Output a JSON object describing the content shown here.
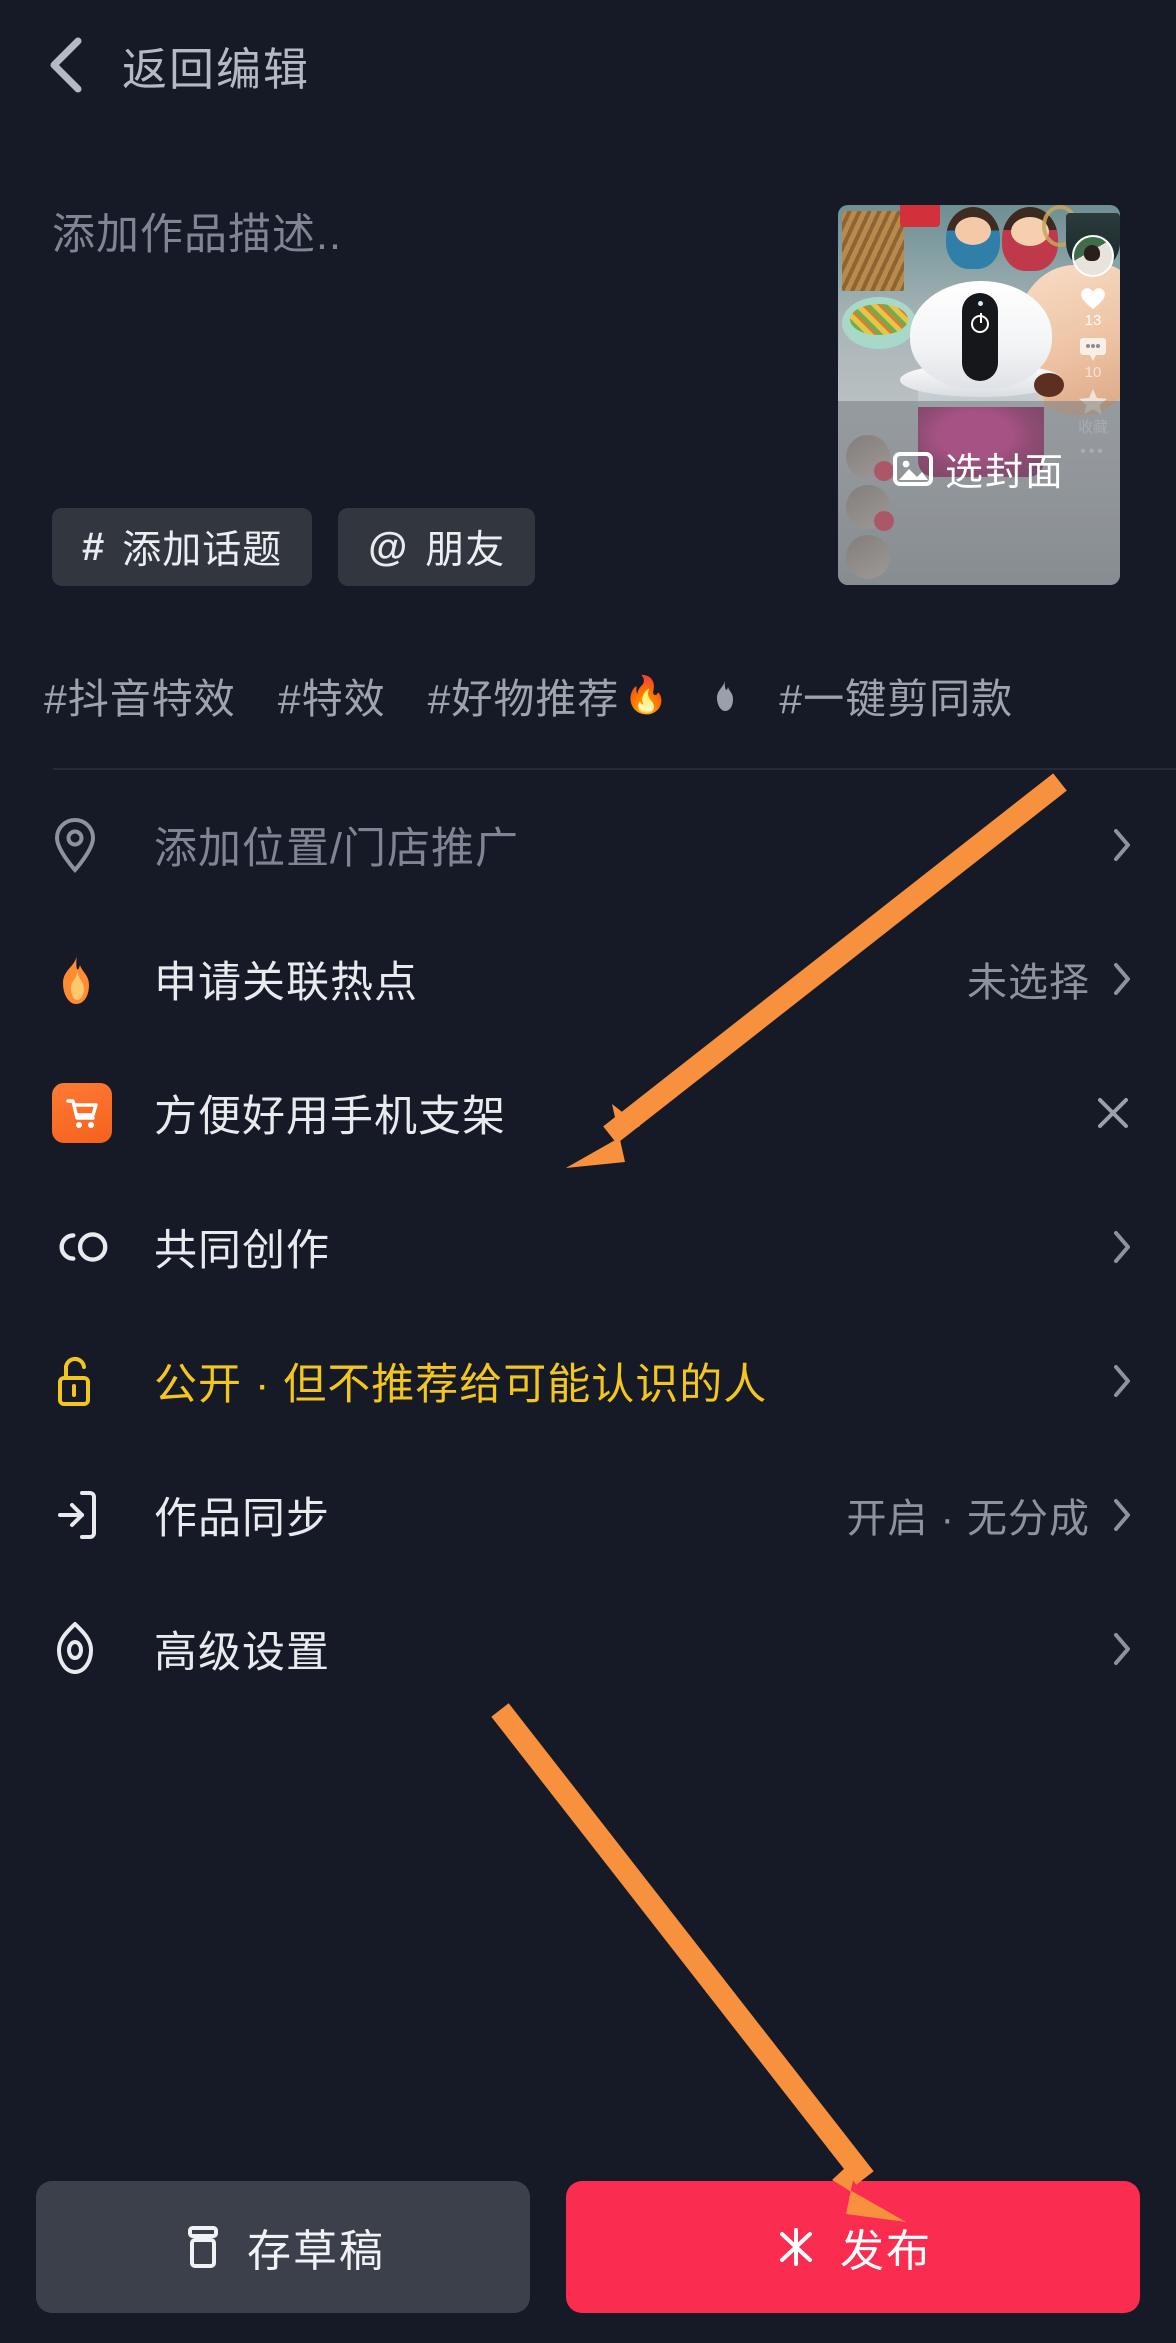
{
  "header": {
    "back_label": "返回编辑",
    "back_icon": "chevron-left-icon"
  },
  "description": {
    "placeholder": "添加作品描述..",
    "value": ""
  },
  "cover": {
    "cta_label": "选封面",
    "cta_icon": "image-icon",
    "likes": "13",
    "comments": "10",
    "favorite_label": "收藏",
    "more_icon": "more-dots-icon"
  },
  "chips": [
    {
      "symbol": "#",
      "label": "添加话题",
      "icon": "hash-icon"
    },
    {
      "symbol": "@",
      "label": "朋友",
      "icon": "at-icon"
    }
  ],
  "suggested_tags": [
    {
      "text": "#抖音特效",
      "trailing": ""
    },
    {
      "text": "#特效",
      "trailing": ""
    },
    {
      "text": "#好物推荐",
      "trailing": "🔥"
    },
    {
      "text": "",
      "trailing": "flame-grey-icon"
    },
    {
      "text": "#一键剪同款",
      "trailing": ""
    }
  ],
  "rows": [
    {
      "key": "location",
      "icon": "location-pin-icon",
      "label": "添加位置/门店推广",
      "muted": true,
      "value": "",
      "trailing": "chevron-right-icon"
    },
    {
      "key": "hotspot",
      "icon": "flame-icon",
      "label": "申请关联热点",
      "muted": false,
      "value": "未选择",
      "trailing": "chevron-right-icon"
    },
    {
      "key": "product",
      "icon": "shopping-cart-icon",
      "label": "方便好用手机支架",
      "muted": false,
      "value": "",
      "trailing": "close-icon"
    },
    {
      "key": "collab",
      "icon": "co-create-icon",
      "label": "共同创作",
      "muted": false,
      "value": "",
      "trailing": "chevron-right-icon"
    },
    {
      "key": "privacy",
      "icon": "unlock-icon",
      "label": "公开 · 但不推荐给可能认识的人",
      "warn": true,
      "value": "",
      "trailing": "chevron-right-icon"
    },
    {
      "key": "sync",
      "icon": "sync-icon",
      "label": "作品同步",
      "muted": false,
      "value": "开启 · 无分成",
      "trailing": "chevron-right-icon"
    },
    {
      "key": "advanced",
      "icon": "settings-hex-icon",
      "label": "高级设置",
      "muted": false,
      "value": "",
      "trailing": "chevron-right-icon"
    }
  ],
  "bottom": {
    "draft_label": "存草稿",
    "draft_icon": "draft-box-icon",
    "publish_label": "发布",
    "publish_icon": "sparkle-icon"
  },
  "colors": {
    "background": "#161a26",
    "publish_red": "#fa2c4f",
    "draft_grey": "#3c404a",
    "accent_orange": "#f7913e",
    "warn_yellow": "#f2c61e",
    "cart_orange": "#f4621d",
    "text_primary": "#e8eaee",
    "text_muted": "#7f8594"
  },
  "annotations": [
    {
      "name": "arrow-to-product-row",
      "color": "#f7913e"
    },
    {
      "name": "arrow-to-publish-button",
      "color": "#f7913e"
    }
  ]
}
